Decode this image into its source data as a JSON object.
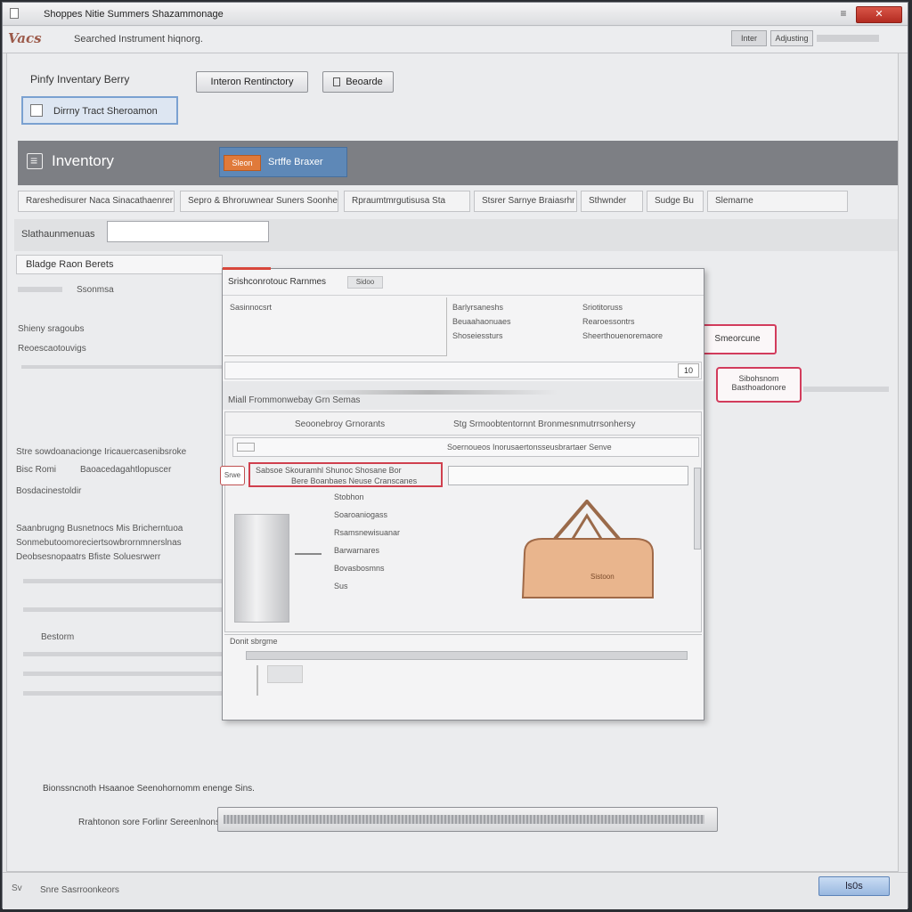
{
  "window": {
    "title": "Shoppes Nitie Summers Shazammonage",
    "minimize": "≡",
    "close": "✕"
  },
  "toolbar": {
    "logo": "Vacs",
    "path": "Searched Instrument hiqnorg.",
    "btn1": "Inter",
    "btn2": "Adjusting"
  },
  "top": {
    "label": "Pinfy Inventary Berry",
    "add_button": "Interon Rentinctory",
    "find_button": "Beoarde",
    "selected": "Dirrny Tract Sheroamon"
  },
  "banner": {
    "title": "Inventory",
    "badge": "Sleon",
    "pill_text": "Srtffe Braxer"
  },
  "filters": [
    "Rareshedisurer Naca Sinacathaenrer",
    "Sepro & Bhroruwnear Suners Soonhenrer",
    "Rpraumtmrgutisusa Sta",
    "Stsrer Sarnye Braiasrhr",
    "Sthwnder",
    "Sudge Bu",
    "Slemarne"
  ],
  "search": {
    "label": "Slathaunmenuas",
    "placeholder": ""
  },
  "left": {
    "header": "Bladge Raon Berets",
    "sub1": "Ssonmsa",
    "sub2": "Shieny sragoubs",
    "sub3": "Reoescaotouvigs",
    "para1": "Stre sowdoanacionge Iricauercasenibsroke",
    "para2a": "Bisc Romi",
    "para2b": "Baoacedagahtlopuscer",
    "para3": "Bosdacinestoldir",
    "para4": "Saanbrugng Busnetnocs Mis Bricherntuoa",
    "para5": "Sonmebutoomoreciertsowbrornmnerslnas",
    "para6": "Deobsesnopaatrs Bfiste Soluesrwerr",
    "tag": "Bestorm"
  },
  "dialog": {
    "title": "Srishconrotouc Rarnmes",
    "title_chip": "Sidoo",
    "info1": "Sasinnocsrt",
    "info_cols": [
      "Barlyrsaneshs",
      "Sriotitoruss",
      "Beuaahaonuaes",
      "Rearoessontrs",
      "Shoseiessturs",
      "Sheerthouenoremaore"
    ],
    "field_num": "10",
    "sep_text": "Miall Frommonwebay Grn Semas",
    "grid_hdr_left": "Seoonebroy Grnorants",
    "grid_hdr_right": "Stg Srmoobtentornnt Bronmesnmutrrsonhersy",
    "row_text": "Soernoueos Inorusaertonsseusbrartaer Senve",
    "sel_line1": "Sabsoe Skouramhl Shunoc Shosane Bor",
    "sel_line2": "Bere Boanbaes Neuse Cranscanes",
    "sel_tag": "Srwe",
    "mini": [
      "Stobhon",
      "Soaroaniogass",
      "Rsamsnewisuanar",
      "Barwarnares",
      "Bovasbosmns",
      "Sus"
    ],
    "bag_label": "Sistoon",
    "bottom_label": "Donit sbrgme"
  },
  "tags": {
    "tag1": "Smeorcune",
    "tag2a": "Sibohsnom",
    "tag2b": "Basthoadonore"
  },
  "footer": {
    "note": "Bionssncnoth Hsaanoe Seenohornomm enenge Sins.",
    "label": "Rrahtonon sore Forlinr Sereenlnons"
  },
  "status": {
    "icon": "Sv",
    "text": "Snre Sasrroonkeors",
    "ok": "ls0s"
  }
}
